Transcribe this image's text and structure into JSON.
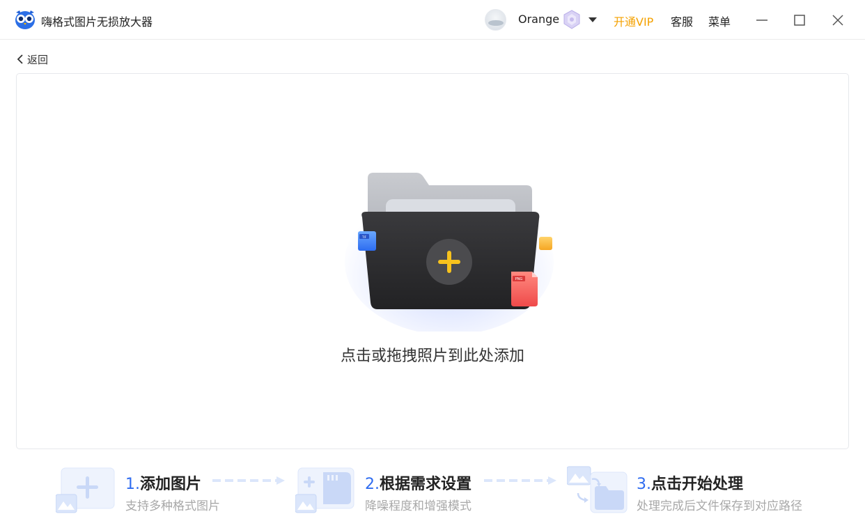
{
  "titlebar": {
    "app_title": "嗨格式图片无损放大器",
    "username": "Orange",
    "vip_label": "开通VIP",
    "service_label": "客服",
    "menu_label": "菜单"
  },
  "nav": {
    "back_label": "返回"
  },
  "dropzone": {
    "prompt": "点击或拖拽照片到此处添加",
    "badges": {
      "tif": "TIF",
      "png": "PNG"
    }
  },
  "steps": [
    {
      "num": "1.",
      "title": "添加图片",
      "desc": "支持多种格式图片"
    },
    {
      "num": "2.",
      "title": "根据需求设置",
      "desc": "降噪程度和增强模式"
    },
    {
      "num": "3.",
      "title": "点击开始处理",
      "desc": "处理完成后文件保存到对应路径"
    }
  ],
  "colors": {
    "accent": "#2f6cf0",
    "vip": "#f4a100",
    "plus": "#f7c21d",
    "folder_dark": "#2c2c2e",
    "step_icon": "#dbe6fb"
  }
}
